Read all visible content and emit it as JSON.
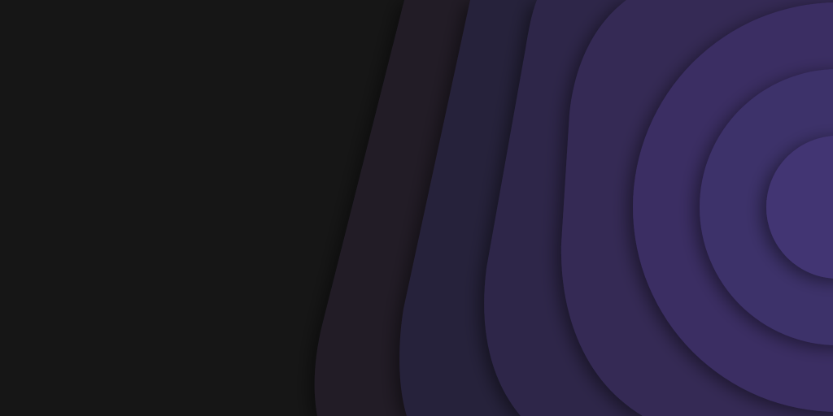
{
  "wallpaper": {
    "background_color": "#161616",
    "layer_colors": [
      "#201d28",
      "#28223a",
      "#2e2848",
      "#342b55",
      "#3a2e63",
      "#3e316b",
      "#433573"
    ],
    "shadow_color": "#000000"
  }
}
